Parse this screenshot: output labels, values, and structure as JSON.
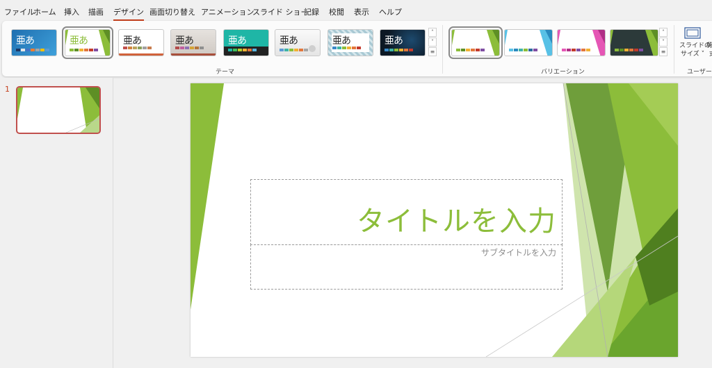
{
  "tabs": [
    "ファイル",
    "ホーム",
    "挿入",
    "描画",
    "デザイン",
    "画面切り替え",
    "アニメーション",
    "スライド ショー",
    "記録",
    "校閲",
    "表示",
    "ヘルプ"
  ],
  "active_tab": "デザイン",
  "themes": {
    "group_label": "テーマ",
    "thumb_text": "亜あ",
    "items": [
      {
        "name": "theme-1",
        "bg": "#2c83c4",
        "text": "#ffffff"
      },
      {
        "name": "theme-2",
        "bg": "#ffffff",
        "text": "#8cbd3a"
      },
      {
        "name": "theme-3",
        "bg": "#ffffff",
        "text": "#262626"
      },
      {
        "name": "theme-4",
        "bg": "#d9d4cf",
        "text": "#262626"
      },
      {
        "name": "theme-5",
        "bg": "#21b8a9",
        "text": "#ffffff"
      },
      {
        "name": "theme-6",
        "bg": "#f4f4f4",
        "text": "#262626"
      },
      {
        "name": "theme-7",
        "bg": "#b9d4dc",
        "text": "#262626"
      },
      {
        "name": "theme-8",
        "bg": "#14202e",
        "text": "#ffffff"
      }
    ]
  },
  "variations": {
    "group_label": "バリエーション"
  },
  "custom_group": {
    "slide_size_label_1": "スライドの",
    "slide_size_label_2": "サイズ ˅",
    "bg_label_1": "背",
    "bg_label_2": "式",
    "group_label": "ユーザー設"
  },
  "slide_panel": {
    "slide_number": "1"
  },
  "slide": {
    "title_placeholder": "タイトルを入力",
    "subtitle_placeholder": "サブタイトルを入力"
  },
  "colors": {
    "accent": "#c43e1c",
    "green": "#8cbd3a"
  }
}
